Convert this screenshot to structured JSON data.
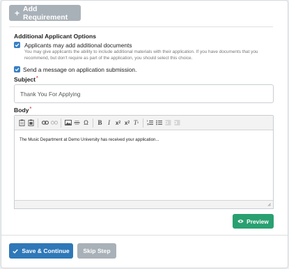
{
  "requirements": {
    "add_label": "Add Requirement"
  },
  "options": {
    "section_title": "Additional Applicant Options",
    "allow_documents": {
      "checked": true,
      "label": "Applicants may add additional documents",
      "help": "You may give applicants the ability to include additional materials with their application. If you have documents that you recommend, but don't require as part of the application, you should select this choice."
    },
    "send_message": {
      "checked": true,
      "label": "Send a message on application submission."
    }
  },
  "subject": {
    "label": "Subject",
    "required_mark": "*",
    "value": "Thank You For Applying"
  },
  "body": {
    "label": "Body",
    "required_mark": "*",
    "content": "The Music Department at Demo University has received your application..."
  },
  "toolbar_icons": [
    "paste-text-icon",
    "paste-word-icon",
    "link-icon",
    "unlink-icon",
    "image-icon",
    "horizontal-rule-icon",
    "special-char-icon",
    "bold-icon",
    "italic-icon",
    "subscript-icon",
    "superscript-icon",
    "remove-format-icon",
    "numbered-list-icon",
    "bulleted-list-icon",
    "decrease-indent-icon",
    "increase-indent-icon"
  ],
  "actions": {
    "preview_label": "Preview",
    "save_label": "Save & Continue",
    "skip_label": "Skip Step"
  },
  "colors": {
    "primary": "#2f78b8",
    "success": "#2aa071",
    "muted": "#a9b1b8",
    "required": "#d9534f"
  }
}
